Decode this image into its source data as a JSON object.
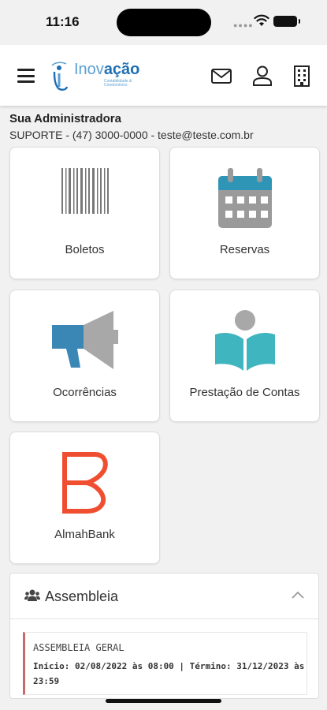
{
  "status_bar": {
    "time": "11:16"
  },
  "header": {
    "logo_text_light": "Inov",
    "logo_text_bold": "ação",
    "logo_subtext": "Contabilidade & Condomínios",
    "icons": [
      "menu-icon",
      "mail-icon",
      "user-icon",
      "building-icon"
    ]
  },
  "admin": {
    "title": "Sua Administradora",
    "contact": "SUPORTE - (47) 3000-0000 - teste@teste.com.br"
  },
  "tiles": [
    {
      "label": "Boletos",
      "icon": "barcode-icon"
    },
    {
      "label": "Reservas",
      "icon": "calendar-icon"
    },
    {
      "label": "Ocorrências",
      "icon": "megaphone-icon"
    },
    {
      "label": "Prestação de Contas",
      "icon": "reading-person-icon"
    },
    {
      "label": "AlmahBank",
      "icon": "almahbank-logo-icon"
    }
  ],
  "assembly": {
    "title": "Assembleia",
    "event_title": "ASSEMBLEIA GERAL",
    "event_dates": "Início: 02/08/2022 às 08:00 | Término: 31/12/2023 às 23:59"
  },
  "colors": {
    "accent_blue": "#1f6fb5",
    "calendar_teal": "#2f95b7",
    "megaphone_blue": "#3a87b6",
    "book_teal": "#3fb5c0",
    "almah_red": "#f04e30",
    "event_border": "#c86a6a"
  }
}
